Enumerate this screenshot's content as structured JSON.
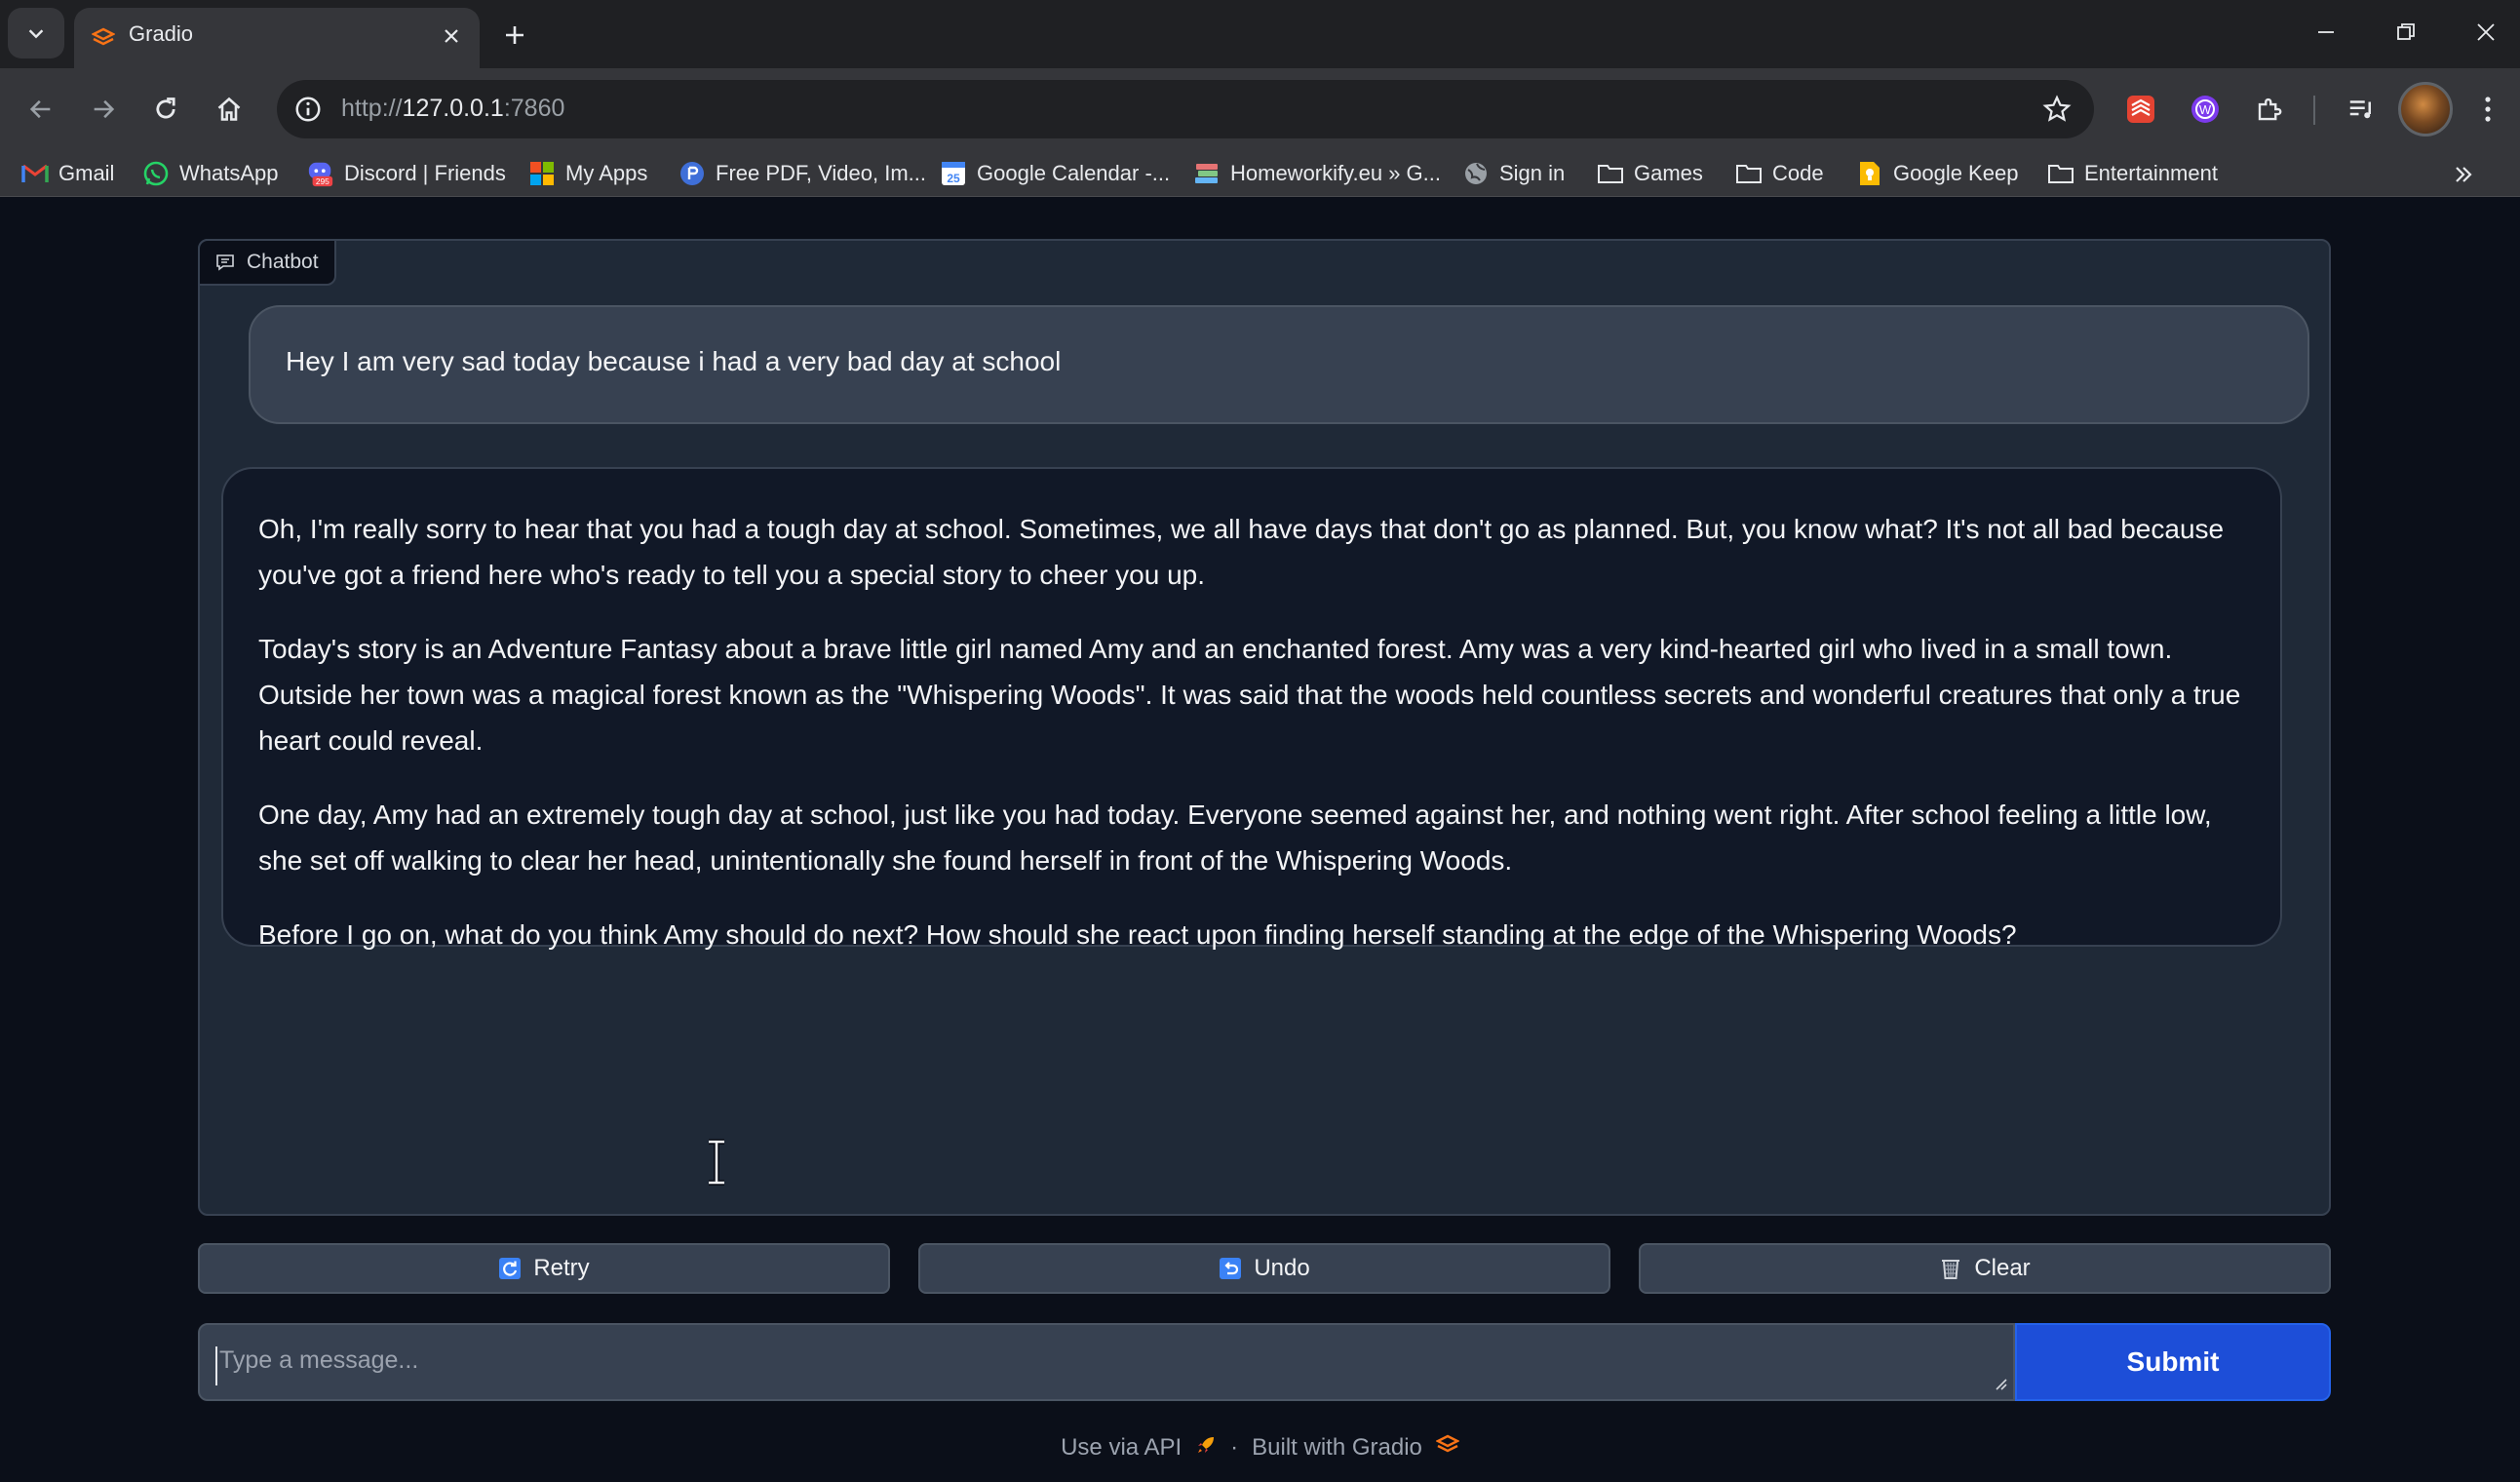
{
  "browser": {
    "tab": {
      "title": "Gradio"
    },
    "url": {
      "scheme": "http://",
      "host": "127.0.0.1",
      "port": ":7860"
    },
    "bookmarks": [
      {
        "label": "Gmail",
        "icon": "gmail-icon"
      },
      {
        "label": "WhatsApp",
        "icon": "whatsapp-icon"
      },
      {
        "label": "Discord | Friends",
        "icon": "discord-icon",
        "badge": "295"
      },
      {
        "label": "My Apps",
        "icon": "microsoft-apps-icon"
      },
      {
        "label": "Free PDF, Video, Im...",
        "icon": "pdf-tool-icon"
      },
      {
        "label": "Google Calendar -...",
        "icon": "google-calendar-icon",
        "badge": "25"
      },
      {
        "label": "Homeworkify.eu » G...",
        "icon": "books-icon"
      },
      {
        "label": "Sign in",
        "icon": "globe-icon"
      },
      {
        "label": "Games",
        "icon": "folder-icon"
      },
      {
        "label": "Code",
        "icon": "folder-icon"
      },
      {
        "label": "Google Keep",
        "icon": "google-keep-icon"
      },
      {
        "label": "Entertainment",
        "icon": "folder-icon"
      }
    ]
  },
  "chatbot": {
    "label": "Chatbot",
    "messages": {
      "user": "Hey I am very sad today because i had a very bad day at school",
      "bot": [
        "Oh, I'm really sorry to hear that you had a tough day at school. Sometimes, we all have days that don't go as planned. But, you know what? It's not all bad because you've got a friend here who's ready to tell you a special story to cheer you up.",
        "Today's story is an Adventure Fantasy about a brave little girl named Amy and an enchanted forest. Amy was a very kind-hearted girl who lived in a small town. Outside her town was a magical forest known as the \"Whispering Woods\". It was said that the woods held countless secrets and wonderful creatures that only a true heart could reveal.",
        "One day, Amy had an extremely tough day at school, just like you had today. Everyone seemed against her, and nothing went right. After school feeling a little low, she set off walking to clear her head, unintentionally she found herself in front of the Whispering Woods.",
        "Before I go on, what do you think Amy should do next? How should she react upon finding herself standing at the edge of the Whispering Woods?"
      ]
    }
  },
  "actions": {
    "retry": "Retry",
    "undo": "Undo",
    "clear": "Clear"
  },
  "input": {
    "placeholder": "Type a message...",
    "value": ""
  },
  "submit": "Submit",
  "footer": {
    "api": "Use via API",
    "separator": "·",
    "built": "Built with Gradio"
  },
  "colors": {
    "accent": "#1d4ed8",
    "background": "#0b0f19",
    "panel": "#1f2937"
  }
}
